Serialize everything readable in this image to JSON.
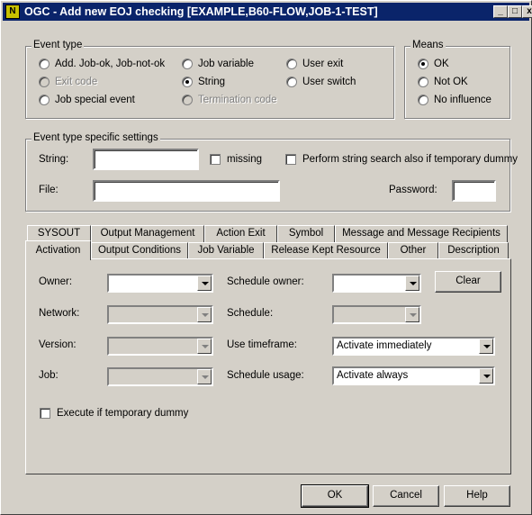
{
  "window": {
    "title": "OGC - Add new EOJ checking [EXAMPLE,B60-FLOW,JOB-1-TEST]",
    "icon_letter": "N",
    "min_label": "_",
    "max_label": "□",
    "close_label": "x"
  },
  "event_type": {
    "label": "Event type",
    "options": [
      {
        "label": "Add. Job-ok, Job-not-ok",
        "checked": false,
        "enabled": true
      },
      {
        "label": "Job variable",
        "checked": false,
        "enabled": true
      },
      {
        "label": "User exit",
        "checked": false,
        "enabled": true
      },
      {
        "label": "Exit code",
        "checked": false,
        "enabled": false
      },
      {
        "label": "String",
        "checked": true,
        "enabled": true
      },
      {
        "label": "User switch",
        "checked": false,
        "enabled": true
      },
      {
        "label": "Job special event",
        "checked": false,
        "enabled": true
      },
      {
        "label": "Termination code",
        "checked": false,
        "enabled": false
      }
    ]
  },
  "means": {
    "label": "Means",
    "options": [
      {
        "label": "OK",
        "checked": true
      },
      {
        "label": "Not OK",
        "checked": false
      },
      {
        "label": "No influence",
        "checked": false
      }
    ]
  },
  "specific": {
    "label": "Event type specific settings",
    "string_label": "String:",
    "string_value": "",
    "missing_label": "missing",
    "perform_label": "Perform string search also if temporary dummy",
    "file_label": "File:",
    "file_value": "",
    "password_label": "Password:",
    "password_value": ""
  },
  "tabs_row1": [
    "SYSOUT",
    "Output Management",
    "Action Exit",
    "Symbol",
    "Message and Message Recipients"
  ],
  "tabs_row2": [
    "Activation",
    "Output Conditions",
    "Job Variable",
    "Release Kept Resource",
    "Other",
    "Description"
  ],
  "activation": {
    "owner_label": "Owner:",
    "owner_value": "",
    "network_label": "Network:",
    "network_value": "",
    "version_label": "Version:",
    "version_value": "",
    "job_label": "Job:",
    "job_value": "",
    "schedule_owner_label": "Schedule owner:",
    "schedule_owner_value": "",
    "schedule_label": "Schedule:",
    "schedule_value": "",
    "use_timeframe_label": "Use timeframe:",
    "use_timeframe_value": "Activate immediately",
    "schedule_usage_label": "Schedule usage:",
    "schedule_usage_value": "Activate always",
    "clear_label": "Clear",
    "execute_label": "Execute if temporary dummy"
  },
  "buttons": {
    "ok": "OK",
    "cancel": "Cancel",
    "help": "Help"
  }
}
